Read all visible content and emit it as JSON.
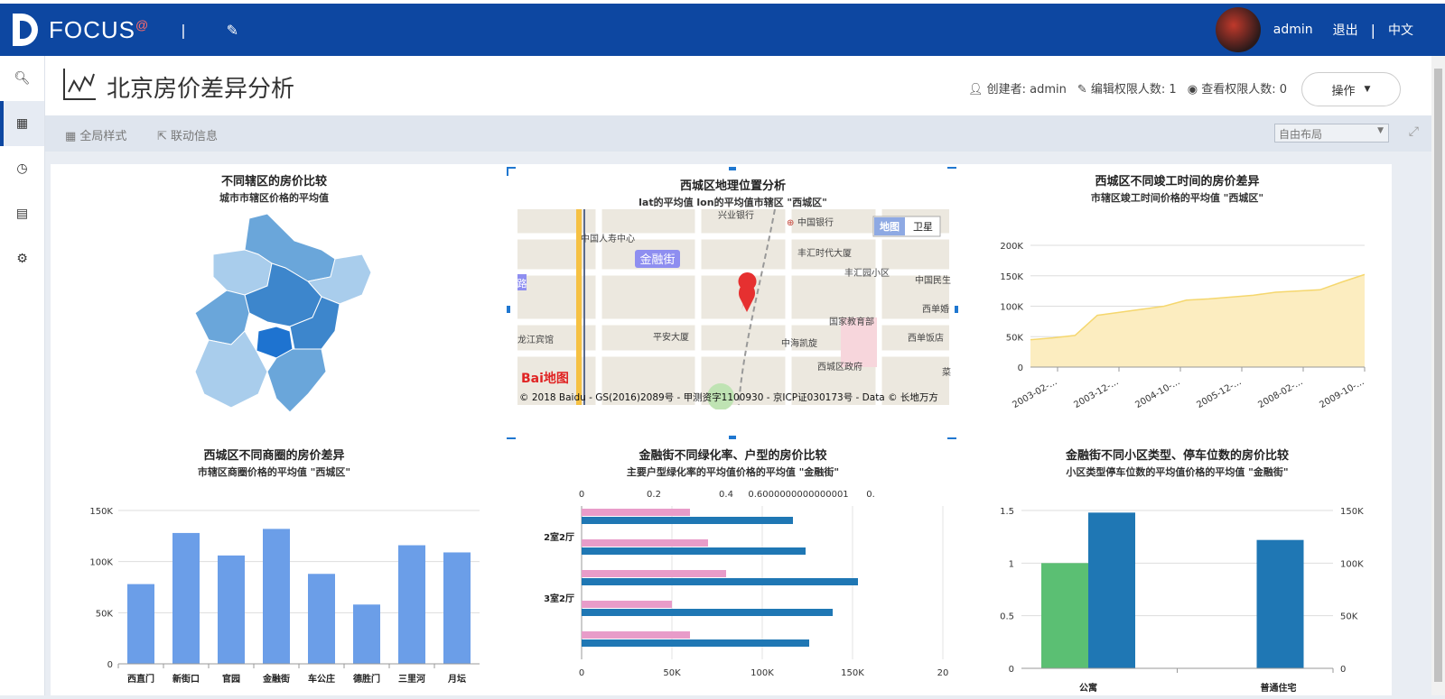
{
  "topbar": {
    "logo": "FOCUS",
    "logo_at": "@",
    "user": "admin",
    "logout": "退出",
    "lang": "中文",
    "sep": "|"
  },
  "sidebar": {
    "icons": [
      "search-icon",
      "grid-icon",
      "clock-icon",
      "calendar-icon",
      "gear-icon"
    ]
  },
  "page": {
    "title": "北京房价差异分析",
    "creator": "创建者: admin",
    "edit_count": "编辑权限人数: 1",
    "view_count": "查看权限人数: 0",
    "op_button": "操作"
  },
  "toolbar": {
    "global_style": "全局样式",
    "link_info": "联动信息",
    "layout": "自由布局"
  },
  "panels": {
    "p1": {
      "title": "不同辖区的房价比较",
      "subtitle": "城市市辖区价格的平均值"
    },
    "p2": {
      "title": "西城区地理位置分析",
      "subtitle": "lat的平均值 lon的平均值市辖区 \"西城区\"",
      "map_btn": "地图",
      "sat_btn": "卫星",
      "labels": [
        "兴业银行",
        "中国银行",
        "中国人寿中心",
        "金融街",
        "丰汇时代大厦",
        "丰汇园小区",
        "中国民生",
        "国家教育部",
        "西单婚",
        "平安大厦",
        "中海凯旋",
        "西单饭店",
        "西城区政府",
        "龙江宾馆",
        "路",
        "菜"
      ],
      "copyright": "© 2018 Baidu - GS(2016)2089号 - 甲测资字1100930 - 京ICP证030173号 - Data © 长地万方",
      "baidu": "Bai地图"
    },
    "p3": {
      "title": "西城区不同竣工时间的房价差异",
      "subtitle": "市辖区竣工时间价格的平均值 \"西城区\""
    },
    "p4": {
      "title": "西城区不同商圈的房价差异",
      "subtitle": "市辖区商圈价格的平均值 \"西城区\""
    },
    "p5": {
      "title": "金融街不同绿化率、户型的房价比较",
      "subtitle": "主要户型绿化率的平均值价格的平均值 \"金融街\""
    },
    "p6": {
      "title": "金融街不同小区类型、停车位数的房价比较",
      "subtitle": "小区类型停车位数的平均值价格的平均值 \"金融街\""
    }
  },
  "chart_data": [
    {
      "type": "area",
      "title": "西城区不同竣工时间的房价差异",
      "x_ticks": [
        "2003-02-...",
        "2003-12-...",
        "2004-10-...",
        "2005-12-...",
        "2008-02-...",
        "2009-10-..."
      ],
      "y_ticks": [
        "0",
        "50K",
        "100K",
        "150K",
        "200K"
      ],
      "ylim": [
        0,
        200000
      ],
      "values": [
        45000,
        48000,
        52000,
        85000,
        90000,
        95000,
        100000,
        110000,
        112000,
        115000,
        118000,
        123000,
        125000,
        127000,
        140000,
        152000
      ],
      "color": "#f5d76e"
    },
    {
      "type": "bar",
      "title": "西城区不同商圈的房价差异",
      "categories": [
        "西直门",
        "新街口",
        "官园",
        "金融街",
        "车公庄",
        "德胜门",
        "三里河",
        "月坛"
      ],
      "values": [
        78000,
        128000,
        106000,
        132000,
        88000,
        58000,
        116000,
        109000
      ],
      "y_ticks": [
        "0",
        "50K",
        "100K",
        "150K"
      ],
      "ylim": [
        0,
        150000
      ],
      "color": "#6b9ee8"
    },
    {
      "type": "bar",
      "title": "金融街不同绿化率、户型的房价比较",
      "orientation": "horizontal",
      "row_labels": [
        "2室2厅",
        "3室2厅"
      ],
      "top_ticks": [
        "0",
        "0.2",
        "0.4",
        "0.6000000000000001",
        "0."
      ],
      "bottom_ticks": [
        "0",
        "50K",
        "100K",
        "150K",
        "20"
      ],
      "series": [
        {
          "name": "绿化率",
          "color": "#e89cc9",
          "values": [
            0.3,
            0.35,
            0.4,
            0.25,
            0.3
          ]
        },
        {
          "name": "价格",
          "color": "#1f77b4",
          "values": [
            117000,
            124000,
            153000,
            139000,
            126000
          ]
        }
      ]
    },
    {
      "type": "bar",
      "title": "金融街不同小区类型、停车位数的房价比较",
      "categories": [
        "公寓",
        "普通住宅"
      ],
      "left_ticks": [
        "0",
        "0.5",
        "1",
        "1.5"
      ],
      "right_ticks": [
        "0",
        "50K",
        "100K",
        "150K"
      ],
      "series": [
        {
          "name": "停车位数",
          "color": "#5bbf73",
          "values": [
            1,
            null
          ]
        },
        {
          "name": "价格",
          "color": "#1f77b4",
          "values": [
            148000,
            122000
          ]
        }
      ]
    }
  ]
}
